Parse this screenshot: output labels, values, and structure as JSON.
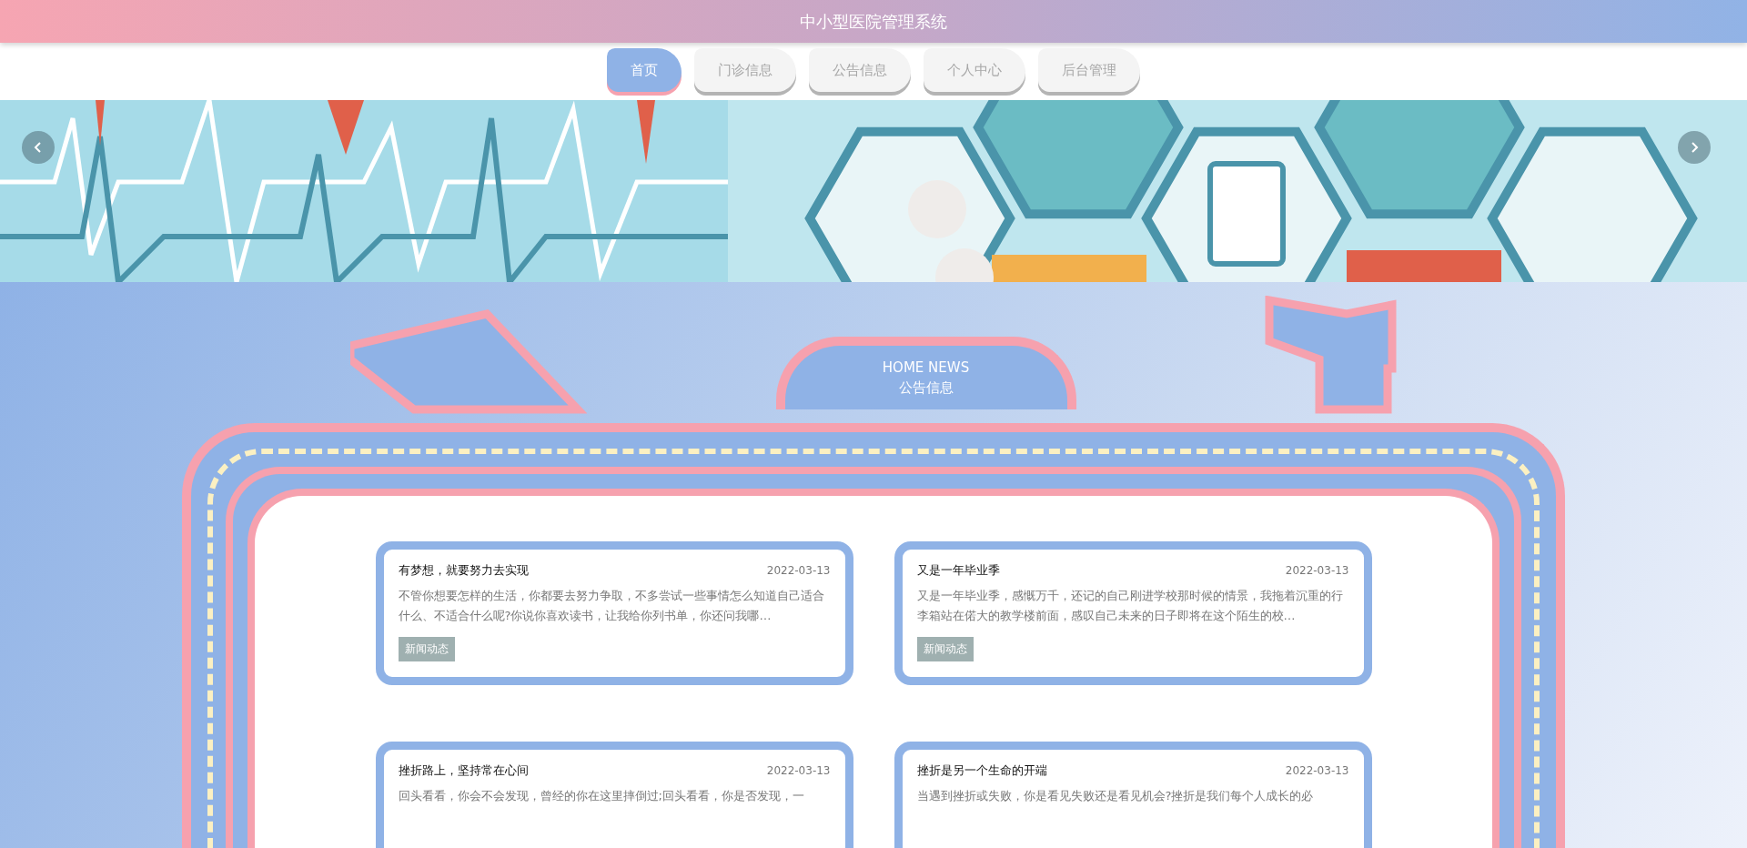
{
  "header": {
    "title": "中小型医院管理系统"
  },
  "nav": [
    {
      "label": "首页",
      "selected": true
    },
    {
      "label": "门诊信息",
      "selected": false
    },
    {
      "label": "公告信息",
      "selected": false
    },
    {
      "label": "个人中心",
      "selected": false
    },
    {
      "label": "后台管理",
      "selected": false
    }
  ],
  "section": {
    "title_en": "HOME NEWS",
    "title": "公告信息"
  },
  "news": [
    {
      "title": "有梦想，就要努力去实现",
      "date": "2022-03-13",
      "summary": "不管你想要怎样的生活，你都要去努力争取，不多尝试一些事情怎么知道自己适合什么、不适合什么呢?你说你喜欢读书，让我给你列书单，你还问我哪…",
      "tag": "新闻动态"
    },
    {
      "title": "又是一年毕业季",
      "date": "2022-03-13",
      "summary": "又是一年毕业季，感慨万千，还记的自己刚进学校那时候的情景，我拖着沉重的行李箱站在偌大的教学楼前面，感叹自己未来的日子即将在这个陌生的校…",
      "tag": "新闻动态"
    },
    {
      "title": "挫折路上，坚持常在心间",
      "date": "2022-03-13",
      "summary": "回头看看，你会不会发现，曾经的你在这里摔倒过;回头看看，你是否发现，一"
    },
    {
      "title": "挫折是另一个生命的开端",
      "date": "2022-03-13",
      "summary": "当遇到挫折或失败，你是看见失败还是看见机会?挫折是我们每个人成长的必"
    }
  ]
}
